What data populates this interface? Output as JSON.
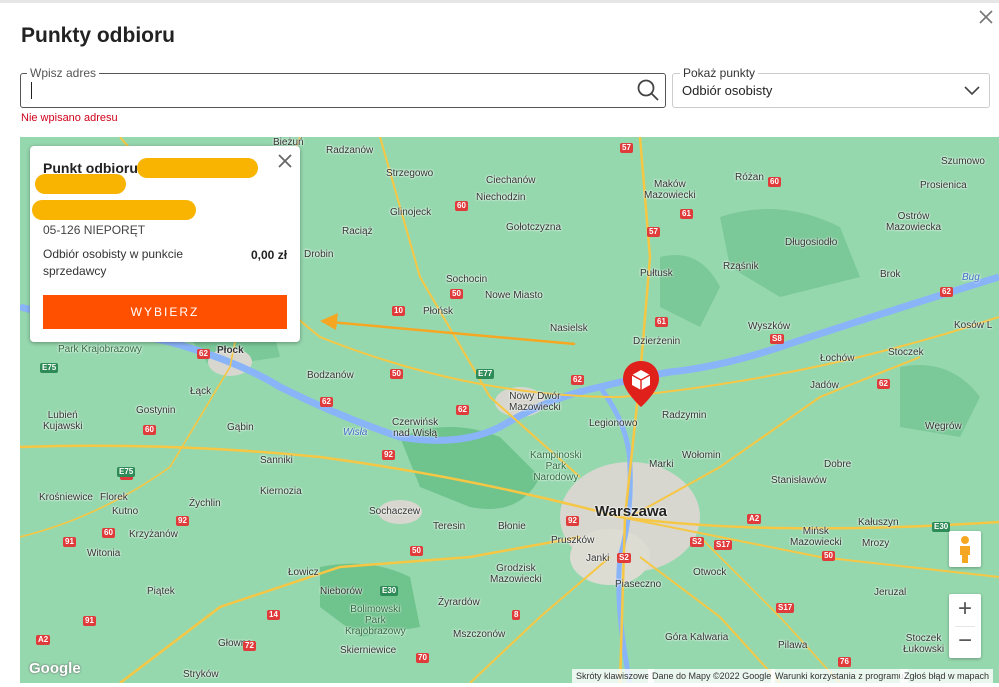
{
  "dialog": {
    "title": "Punkty odbioru"
  },
  "address": {
    "legend": "Wpisz adres",
    "value": "",
    "placeholder": "",
    "error": "Nie wpisano adresu"
  },
  "filter": {
    "legend": "Pokaż punkty",
    "value": "Odbiór osobisty"
  },
  "popup": {
    "title": "Punkt odbioru",
    "postal": "05-126 NIEPORĘT",
    "method": "Odbiór osobisty w punkcie sprzedawcy",
    "price": "0,00 zł",
    "button": "WYBIERZ"
  },
  "map": {
    "labels": {
      "warszawa": "Warszawa",
      "plock": "Płock",
      "legionowo": "Legionowo",
      "radzymin": "Radzymin",
      "marki": "Marki",
      "wolomin": "Wołomin",
      "pruszkow": "Pruszków",
      "piaseczno": "Piaseczno",
      "otwock": "Otwock",
      "nasielsk": "Nasielsk",
      "pultusk": "Pułtusk",
      "ciechanow": "Ciechanów",
      "plonsk": "Płońsk",
      "wyszkow": "Wyszków",
      "minsk": "Mińsk\nMazowiecki",
      "sochaczew": "Sochaczew",
      "zyrardow": "Żyrardów",
      "grodzisk": "Grodzisk\nMazowiecki",
      "blonie": "Błonie",
      "serock": "Dzierżenin",
      "nowydwor": "Nowy Dwór\nMazowiecki",
      "gostynin": "Gostynin",
      "kutno": "Kutno",
      "lowicz": "Łowicz",
      "skierniewice": "Skierniewice",
      "makow": "Maków\nMazowiecki",
      "rozan": "Różan",
      "ostrow": "Ostrów\nMazowiecka",
      "kampinos": "Kampinoski\nPark\nNarodowy",
      "bolimowski": "Bolimowski\nPark\nKrajobrazowy",
      "wisla": "Wisła",
      "bug": "Bug",
      "radziejow": "Raciąż",
      "glinojeck": "Glinojeck",
      "strzegowo": "Strzegowo",
      "niechodzin": "Niechodzin",
      "golotczyzna": "Gołotczyzna",
      "sochocin": "Sochocin",
      "nowemiasto": "Nowe Miasto",
      "drobin": "Drobin",
      "bodzanow": "Bodzanów",
      "czerwinsk": "Czerwińsk\nnad Wisłą",
      "sanniki": "Sanniki",
      "kiernozia": "Kiernozia",
      "gabin": "Gąbin",
      "lack": "Łąck",
      "teresin": "Teresin",
      "janki": "Janki",
      "mszczonow": "Mszczonów",
      "nieborow": "Nieborów",
      "glowno": "Głowno",
      "strykow": "Stryków",
      "pilawa": "Pilawa",
      "garwolin": "Góra Kalwaria",
      "lochow": "Łochów",
      "jadow": "Jadów",
      "stoczek": "Stoczek",
      "wegrow": "Węgrów",
      "dobre": "Dobre",
      "stanislawow": "Stanisławów",
      "kaluszyn": "Kałuszyn",
      "mrozy": "Mrozy",
      "jeruzal": "Jeruzal",
      "latowicz": "Stoczek\nŁukowski",
      "szumowo": "Szumowo",
      "prosienica": "Prosienica",
      "brok": "Brok",
      "dlugosiodlo": "Długosiodło",
      "rzasnik": "Rząśnik",
      "kosow": "Kosów L",
      "biezun": "Bieżuń",
      "radzanow": "Radzanów",
      "lubien": "Lubień\nKujawski",
      "krosniewice": "Krośniewice",
      "florek": "Florek",
      "krzyzanow": "Krzyżanów",
      "witonia": "Witonia",
      "piatek": "Piątek",
      "zychlin": "Żychlin",
      "parkkraj": "Park Krajobrazowy"
    },
    "attribution": {
      "shortcuts": "Skróty klawiszowe",
      "data": "Dane do Mapy ©2022 Google",
      "terms": "Warunki korzystania z programu",
      "report": "Zgłoś błąd w mapach"
    },
    "logo": "Google",
    "zoom_in": "+",
    "zoom_out": "−"
  },
  "colors": {
    "accent": "#ff5000",
    "error": "#d0021b",
    "highlight": "#f8b400",
    "pin": "#e0211b",
    "map_green": "#8fd4a8"
  },
  "icons": {
    "close": "close-icon",
    "search": "search-icon",
    "chevron": "chevron-down-icon",
    "pin": "map-pin-icon",
    "pegman": "street-view-icon"
  }
}
